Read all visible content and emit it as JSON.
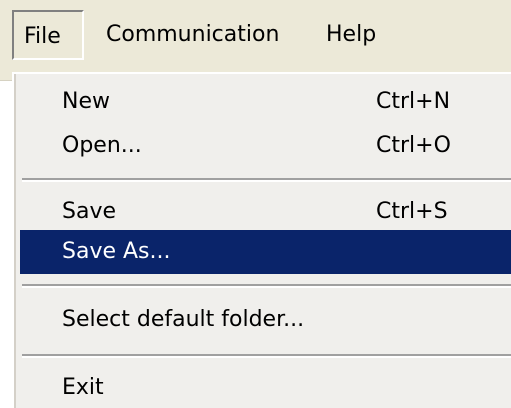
{
  "menubar": {
    "file": "File",
    "communication": "Communication",
    "help": "Help"
  },
  "file_menu": {
    "new": {
      "label": "New",
      "shortcut": "Ctrl+N"
    },
    "open": {
      "label": "Open...",
      "shortcut": "Ctrl+O"
    },
    "save": {
      "label": "Save",
      "shortcut": "Ctrl+S"
    },
    "save_as": {
      "label": "Save As..."
    },
    "select_default_folder": {
      "label": "Select default folder..."
    },
    "exit": {
      "label": "Exit"
    }
  },
  "colors": {
    "menu_background": "#ece9d8",
    "selection_background": "#0a246a",
    "selection_text": "#ffffff"
  }
}
